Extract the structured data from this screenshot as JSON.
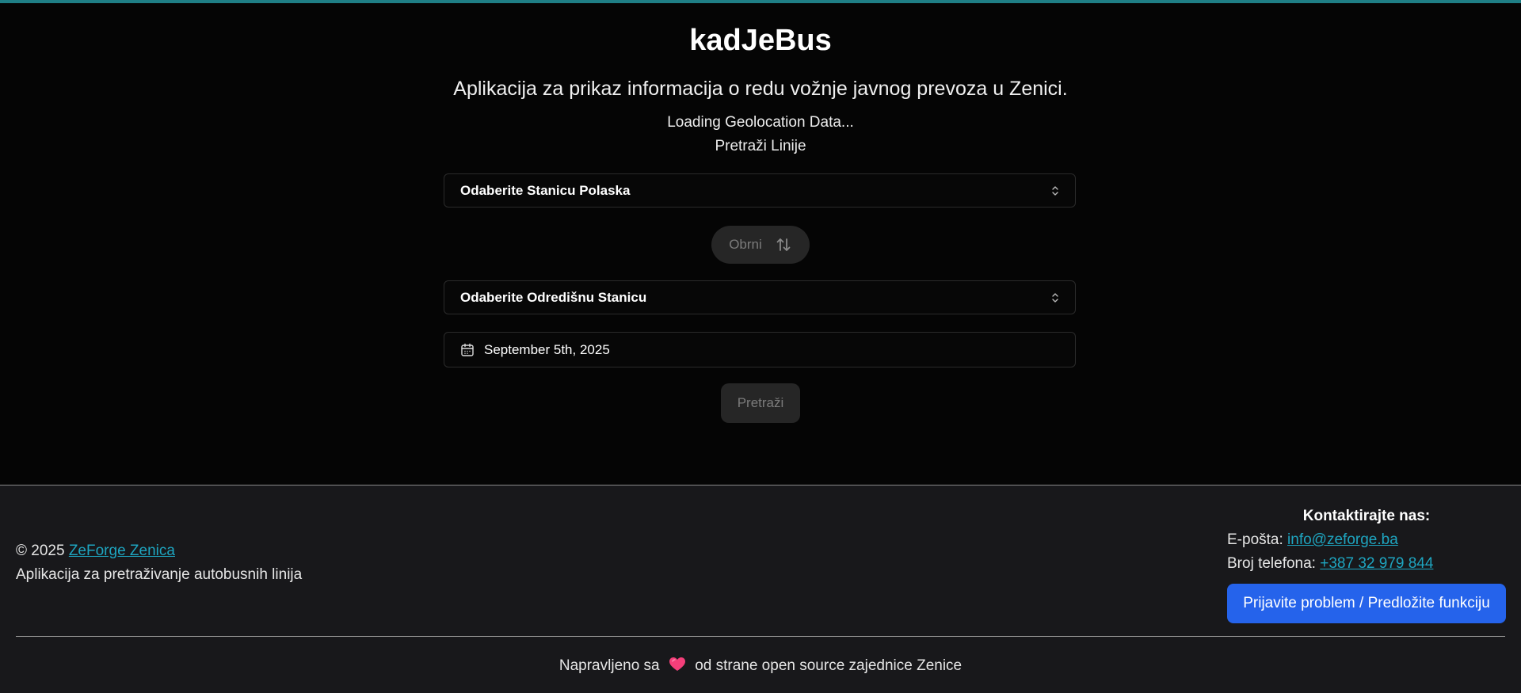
{
  "app": {
    "title": "kadJeBus",
    "subtitle": "Aplikacija za prikaz informacija o redu vožnje javnog prevoza u Zenici.",
    "geo_status": "Loading Geolocation Data...",
    "search_heading": "Pretraži Linije"
  },
  "form": {
    "from_station": "Odaberite Stanicu Polaska",
    "swap_label": "Obrni",
    "to_station": "Odaberite Odredišnu Stanicu",
    "date": "September 5th, 2025",
    "search_label": "Pretraži"
  },
  "footer": {
    "copyright": "© 2025",
    "org_link": "ZeForge Zenica",
    "description": "Aplikacija za pretraživanje autobusnih linija",
    "contact_title": "Kontaktirajte nas:",
    "email_label": "E-pošta:",
    "email": "info@zeforge.ba",
    "phone_label": "Broj telefona:",
    "phone": "+387 32 979 844",
    "report_button": "Prijavite problem / Predložite funkciju",
    "made_with_prefix": "Napravljeno sa",
    "made_with_suffix": "od strane open source zajednice Zenice"
  },
  "colors": {
    "accent_top": "#1f7f86",
    "link": "#1ea5c0",
    "primary_button": "#2563eb",
    "heart": "#f43f7a"
  },
  "icons": {
    "swap": "arrows-up-down-icon",
    "select": "chevron-up-down-icon",
    "calendar": "calendar-icon",
    "heart": "heart-icon"
  }
}
